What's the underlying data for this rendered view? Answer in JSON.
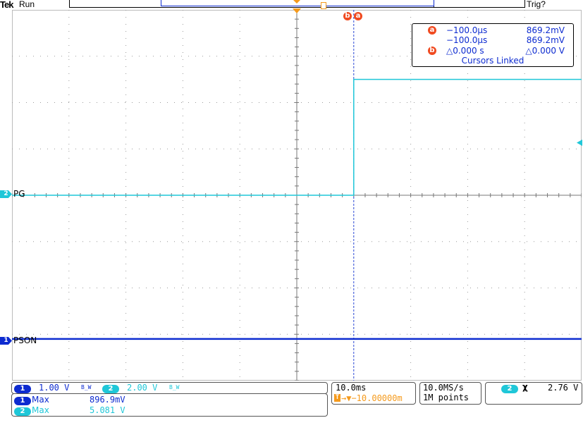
{
  "header": {
    "brand": "Tek",
    "acq_status": "Run",
    "trigger_status": "Trig?"
  },
  "cursor_readout": {
    "a": {
      "badge": "a",
      "time": "−100.0µs",
      "value": "869.2mV"
    },
    "b_row1": {
      "time": "−100.0µs",
      "value": "869.2mV"
    },
    "delta": {
      "badge": "b",
      "time": "△0.000 s",
      "value": "△0.000 V"
    },
    "status": "Cursors Linked"
  },
  "cursor_top_labels": {
    "b": "b",
    "a": "a"
  },
  "channels": {
    "ch1": {
      "number": "1",
      "label": "PSON",
      "scale": "1.00 V",
      "color": "#0d2bd0"
    },
    "ch2": {
      "number": "2",
      "label": "PG",
      "scale": "2.00 V",
      "color": "#1fc7d8"
    }
  },
  "bandwidth_marks": {
    "ch1": "B_W",
    "ch2": "B_W"
  },
  "measurements": [
    {
      "ch": "1",
      "name": "Max",
      "value": "896.9mV"
    },
    {
      "ch": "2",
      "name": "Max",
      "value": "5.081 V"
    }
  ],
  "timebase": {
    "time_per_div": "10.0ms",
    "position": "→▼−10.00000m",
    "trigger_icon": "T"
  },
  "acquisition": {
    "sample_rate": "10.0MS/s",
    "record_length": "1M points"
  },
  "trigger": {
    "source": "2",
    "slope_icon": "χ",
    "level": "2.76 V"
  },
  "waveform_data": {
    "grid_divisions": {
      "x": 10,
      "y": 8
    },
    "ch2_pg": {
      "low_level_div": 0,
      "high_level_div": 2.5,
      "edge_time_div": 1.0
    },
    "ch1_pson": {
      "level_div": -3.1
    },
    "cursor_time_div": 1.0
  }
}
